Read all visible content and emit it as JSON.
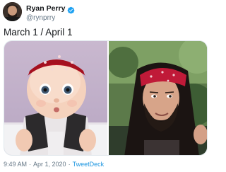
{
  "author": {
    "display_name": "Ryan Perry",
    "handle": "@rynprry",
    "verified": true
  },
  "tweet": {
    "text": "March 1 / April 1"
  },
  "media": {
    "count": 2
  },
  "footer": {
    "time": "9:49 AM",
    "separator": "·",
    "date": "Apr 1, 2020",
    "source": "TweetDeck"
  },
  "colors": {
    "text": "#14171a",
    "secondary": "#657786",
    "link": "#1b95e0",
    "verified": "#1da1f2"
  }
}
